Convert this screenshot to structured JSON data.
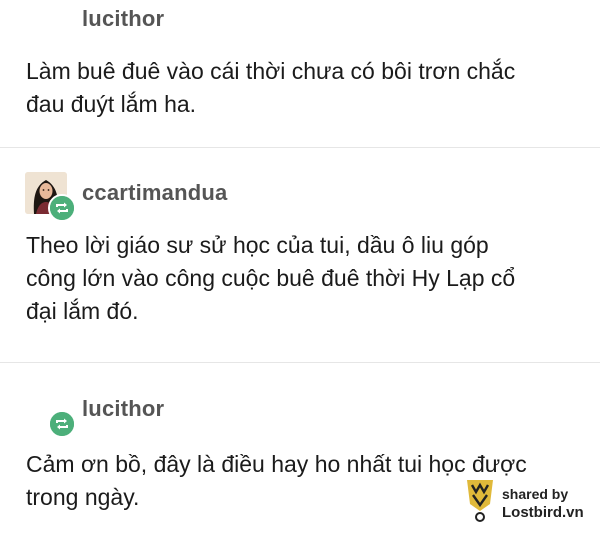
{
  "posts": [
    {
      "username": "lucithor",
      "text_lines": [
        "Làm buê đuê vào cái thời chưa có bôi trơn chắc",
        "đau đuýt lắm ha."
      ],
      "has_avatar": false,
      "reblog_badge": false
    },
    {
      "username": "ccartimandua",
      "text_lines": [
        "Theo lời giáo sư sử học của tui, dầu ô liu góp",
        "công lớn vào công cuộc buê đuê thời Hy Lạp cổ",
        "đại lắm đó."
      ],
      "has_avatar": true,
      "reblog_badge": true
    },
    {
      "username": "lucithor",
      "text_lines": [
        "Cảm ơn bồ, đây là điều hay ho nhất tui học được",
        "trong ngày."
      ],
      "has_avatar": false,
      "reblog_badge": true
    }
  ],
  "watermark": {
    "line1": "shared by",
    "line2": "Lostbird.vn"
  },
  "colors": {
    "reblog_green": "#4caf7a",
    "username_gray": "#555555",
    "separator": "#e6e6e6",
    "logo_gold": "#e0b93a"
  },
  "icons": {
    "reblog": "reblog-icon",
    "logo": "lostbird-logo-icon"
  }
}
